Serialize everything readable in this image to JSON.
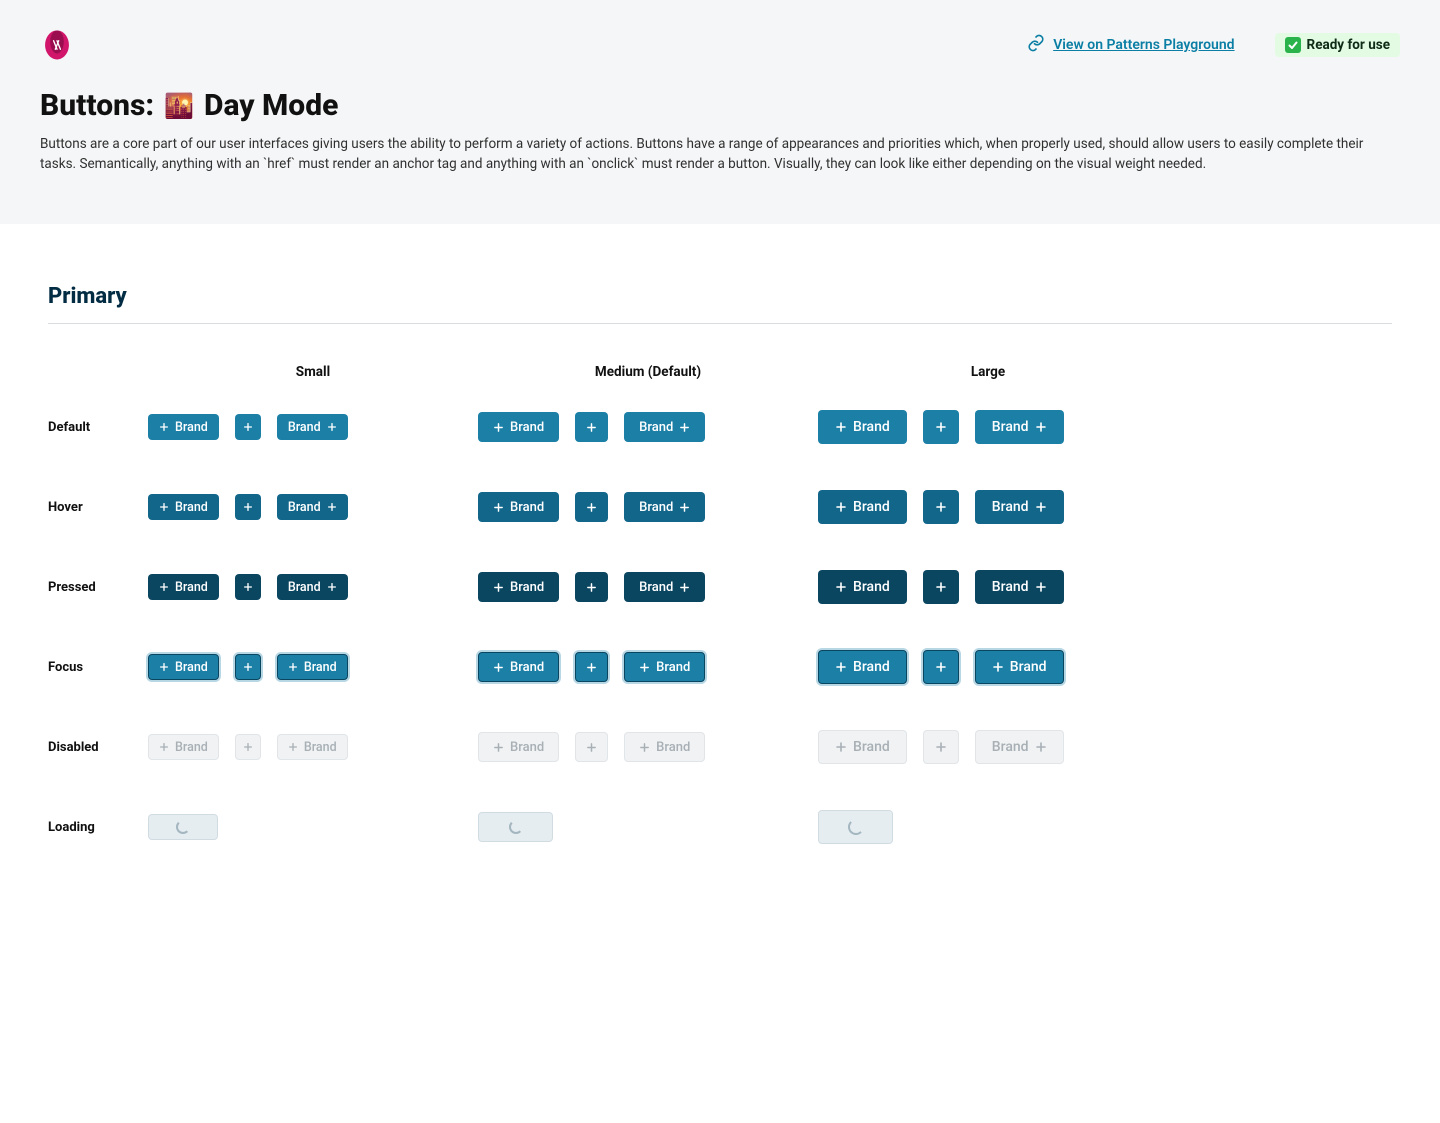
{
  "header": {
    "playground_link": "View on Patterns Playground",
    "status_badge": "Ready for use"
  },
  "page": {
    "title_prefix": "Buttons:",
    "title_mode": "Day Mode",
    "description": "Buttons are a core part of our user interfaces giving users the ability to perform a variety of actions. Buttons have a range of appearances and priorities which, when properly used, should allow users to easily complete their tasks. Semantically, anything with an `href` must render an anchor tag and anything with an `onclick` must render a button. Visually, they can look like either depending on the visual weight needed."
  },
  "section": {
    "title": "Primary"
  },
  "columns": {
    "small": "Small",
    "medium": "Medium (Default)",
    "large": "Large"
  },
  "rows": {
    "default": "Default",
    "hover": "Hover",
    "pressed": "Pressed",
    "focus": "Focus",
    "disabled": "Disabled",
    "loading": "Loading"
  },
  "button_label": "Brand"
}
